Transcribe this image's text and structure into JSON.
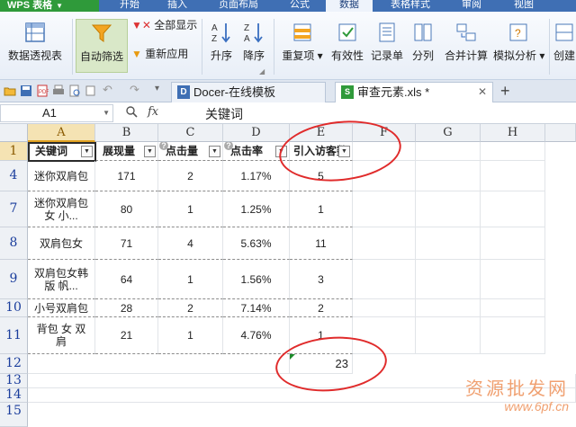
{
  "app": {
    "name": "WPS 表格"
  },
  "tabs": [
    "开始",
    "插入",
    "页面布局",
    "公式",
    "数据",
    "表格样式",
    "审阅",
    "视图"
  ],
  "active_tab": "数据",
  "ribbon": {
    "pivot": "数据透视表",
    "autofilter": "自动筛选",
    "show_all": "全部显示",
    "reapply": "重新应用",
    "sort_asc": "升序",
    "sort_desc": "降序",
    "duplicates": "重复项",
    "validity": "有效性",
    "record": "记录单",
    "split": "分列",
    "consolidate": "合并计算",
    "analysis": "模拟分析",
    "create": "创建"
  },
  "doc_tabs": [
    {
      "label": "Docer-在线模板"
    },
    {
      "label": "审查元素.xls *"
    }
  ],
  "formula_bar": {
    "cell_ref": "A1",
    "fx": "fx",
    "value": "关键词"
  },
  "columns": [
    "A",
    "B",
    "C",
    "D",
    "E",
    "F",
    "G",
    "H"
  ],
  "rows": [
    "1",
    "4",
    "7",
    "8",
    "9",
    "10",
    "11",
    "12",
    "13",
    "14",
    "15"
  ],
  "header": [
    "关键词",
    "展现量",
    "点击量",
    "点击率",
    "引入访客数"
  ],
  "data_rows": [
    [
      "迷你双肩包",
      "171",
      "2",
      "1.17%",
      "5"
    ],
    [
      "迷你双肩包女 小...",
      "80",
      "1",
      "1.25%",
      "1"
    ],
    [
      "双肩包女",
      "71",
      "4",
      "5.63%",
      "11"
    ],
    [
      "双肩包女韩版 帆...",
      "64",
      "1",
      "1.56%",
      "3"
    ],
    [
      "小号双肩包",
      "28",
      "2",
      "7.14%",
      "2"
    ],
    [
      "背包 女 双肩",
      "21",
      "1",
      "4.76%",
      "1"
    ]
  ],
  "sum_value": "23",
  "watermark": {
    "text": "资源批发网",
    "url": "www.6pf.cn"
  },
  "colors": {
    "accent": "#3f6fb4",
    "annotation": "#e02b2b",
    "app_button": "#2f9a3a"
  }
}
